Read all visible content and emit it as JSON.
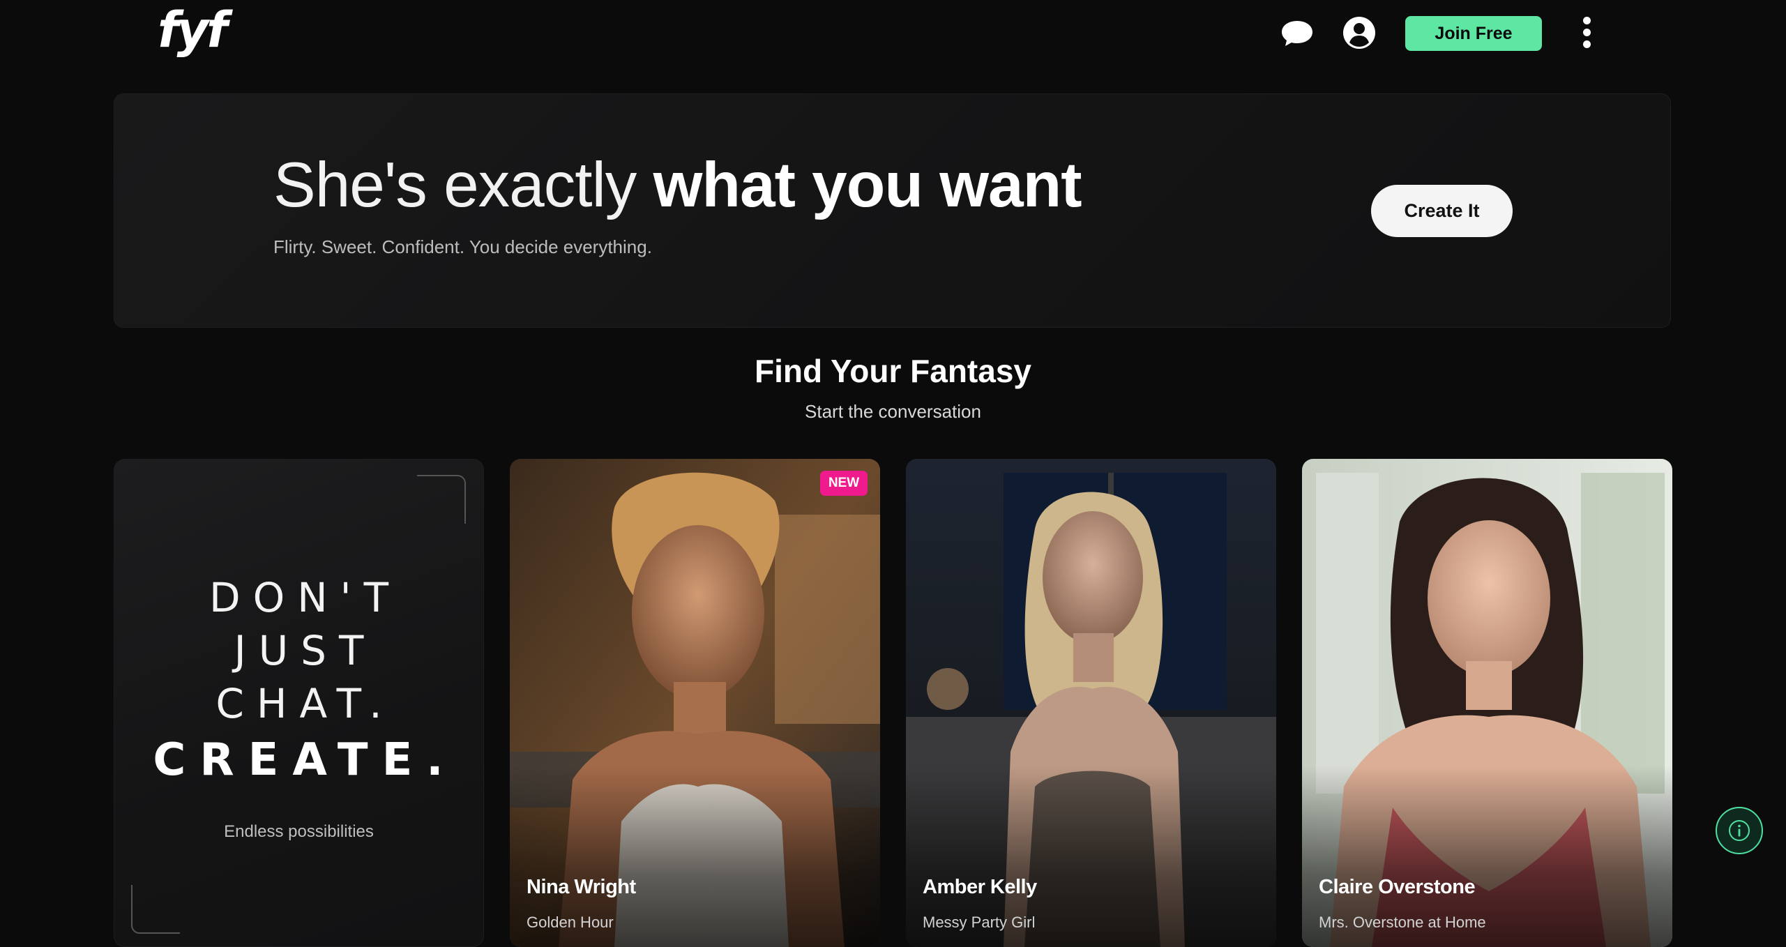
{
  "header": {
    "logo": "fyf",
    "join_label": "Join Free"
  },
  "hero": {
    "title_regular": "She's exactly",
    "title_bold": "what you want",
    "subtitle": "Flirty. Sweet. Confident. You decide everything.",
    "cta_label": "Create It"
  },
  "section": {
    "title": "Find Your Fantasy",
    "subtitle": "Start the conversation"
  },
  "promo_card": {
    "lines": [
      "DON'T",
      "JUST",
      "CHAT."
    ],
    "emphasis": "CREATE.",
    "subtitle": "Endless possibilities"
  },
  "characters": [
    {
      "name": "Nina Wright",
      "tagline": "Golden Hour",
      "badge": "NEW"
    },
    {
      "name": "Amber Kelly",
      "tagline": "Messy Party Girl",
      "badge": ""
    },
    {
      "name": "Claire Overstone",
      "tagline": "Mrs. Overstone at Home",
      "badge": ""
    }
  ],
  "colors": {
    "accent": "#5ee6a3",
    "badge": "#ef1a8b",
    "background": "#0b0b0c"
  },
  "icons": [
    "chat-bubble-icon",
    "user-account-icon",
    "more-vertical-icon",
    "info-icon"
  ]
}
